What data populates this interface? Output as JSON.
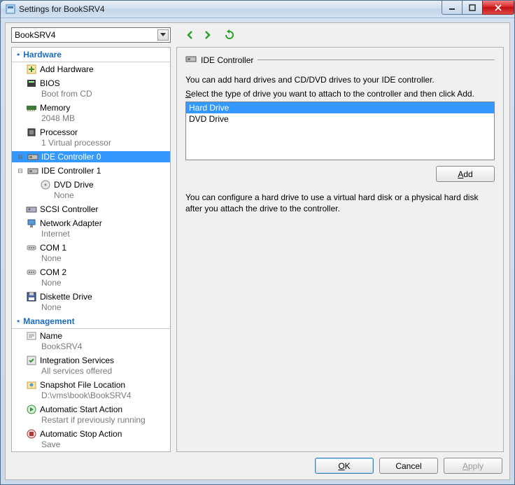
{
  "window": {
    "title": "Settings for BookSRV4"
  },
  "toolbar": {
    "vm_name": "BookSRV4"
  },
  "sidebar": {
    "hardware_header": "Hardware",
    "management_header": "Management",
    "hardware": [
      {
        "label": "Add Hardware",
        "sub": "",
        "icon": "add"
      },
      {
        "label": "BIOS",
        "sub": "Boot from CD",
        "icon": "bios"
      },
      {
        "label": "Memory",
        "sub": "2048 MB",
        "icon": "mem"
      },
      {
        "label": "Processor",
        "sub": "1 Virtual processor",
        "icon": "cpu"
      },
      {
        "label": "IDE Controller 0",
        "sub": "",
        "icon": "ide",
        "selected": true,
        "expandable": true
      },
      {
        "label": "IDE Controller 1",
        "sub": "",
        "icon": "ide",
        "expandable": true,
        "expanded": true,
        "children": [
          {
            "label": "DVD Drive",
            "sub": "None",
            "icon": "dvd"
          }
        ]
      },
      {
        "label": "SCSI Controller",
        "sub": "",
        "icon": "scsi"
      },
      {
        "label": "Network Adapter",
        "sub": "Internet",
        "icon": "net"
      },
      {
        "label": "COM 1",
        "sub": "None",
        "icon": "com"
      },
      {
        "label": "COM 2",
        "sub": "None",
        "icon": "com"
      },
      {
        "label": "Diskette Drive",
        "sub": "None",
        "icon": "floppy"
      }
    ],
    "management": [
      {
        "label": "Name",
        "sub": "BookSRV4",
        "icon": "name"
      },
      {
        "label": "Integration Services",
        "sub": "All services offered",
        "icon": "integ"
      },
      {
        "label": "Snapshot File Location",
        "sub": "D:\\vms\\book\\BookSRV4",
        "icon": "snap"
      },
      {
        "label": "Automatic Start Action",
        "sub": "Restart if previously running",
        "icon": "start"
      },
      {
        "label": "Automatic Stop Action",
        "sub": "Save",
        "icon": "stop"
      }
    ]
  },
  "rightpane": {
    "header": "IDE Controller",
    "desc": "You can add hard drives and CD/DVD drives to your IDE controller.",
    "instr_pre": "S",
    "instr_post": "elect the type of drive you want to attach to the controller and then click Add.",
    "list": [
      "Hard Drive",
      "DVD Drive"
    ],
    "selected_index": 0,
    "add_u": "A",
    "add_rest": "dd",
    "hint": "You can configure a hard drive to use a virtual hard disk or a physical hard disk after you attach the drive to the controller."
  },
  "footer": {
    "ok_u": "O",
    "ok_rest": "K",
    "cancel": "Cancel",
    "apply_u": "A",
    "apply_rest": "pply"
  }
}
